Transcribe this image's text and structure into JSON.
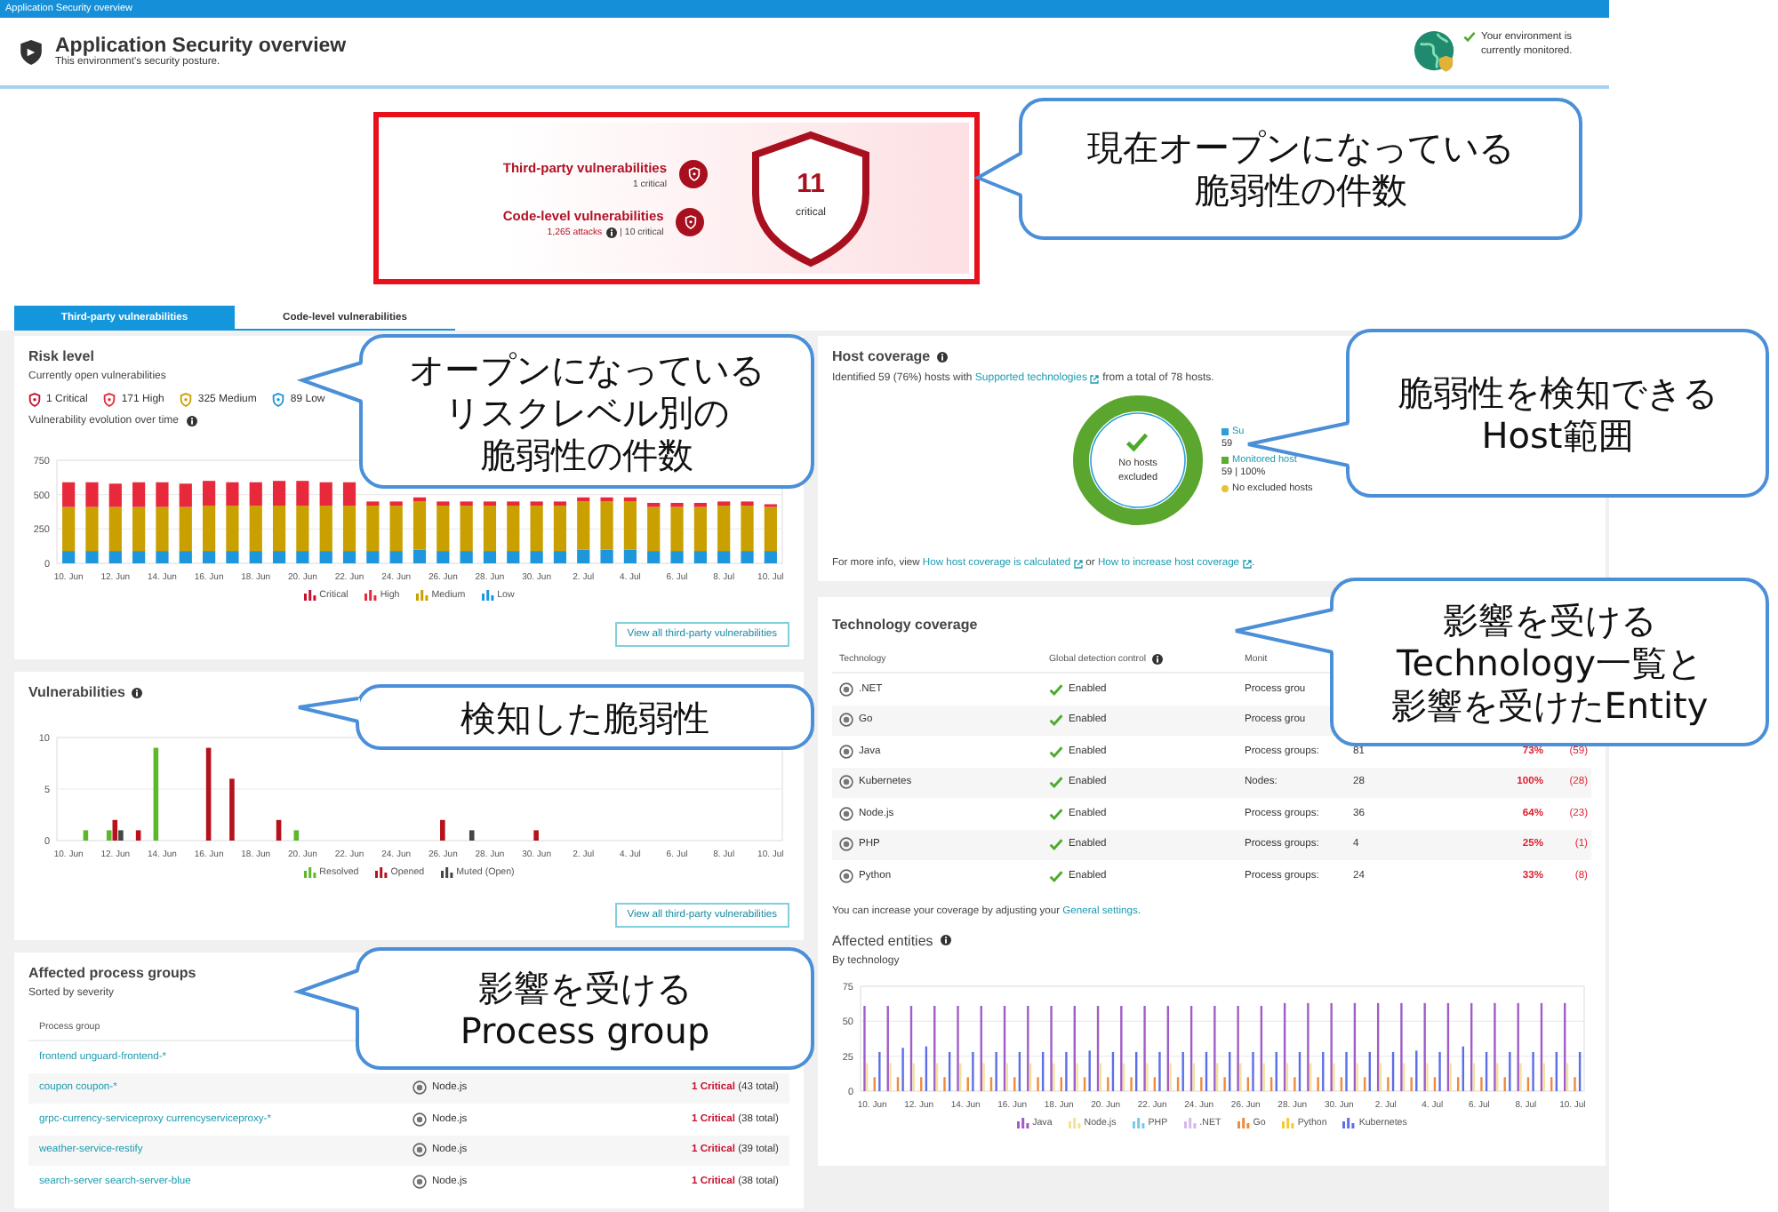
{
  "window": {
    "title": "Application Security overview"
  },
  "header": {
    "title": "Application Security overview",
    "subtitle": "This environment's security posture.",
    "status": "Your environment is currently monitored."
  },
  "summary": {
    "items": [
      {
        "title": "Third-party vulnerabilities",
        "detail": "1 critical"
      },
      {
        "title": "Code-level vulnerabilities",
        "attacks": "1,265 attacks",
        "detail": "| 10 critical"
      }
    ],
    "total": "11",
    "total_label": "critical"
  },
  "tabs": [
    {
      "label": "Third-party vulnerabilities",
      "selected": true
    },
    {
      "label": "Code-level vulnerabilities",
      "selected": false
    }
  ],
  "risk_level": {
    "title": "Risk level",
    "subtitle": "Currently open vulnerabilities",
    "counts": [
      {
        "label": "1 Critical",
        "color": "#c8102e"
      },
      {
        "label": "171 High",
        "color": "#e8293b"
      },
      {
        "label": "325 Medium",
        "color": "#c9a000"
      },
      {
        "label": "89 Low",
        "color": "#1e96dc"
      }
    ],
    "chart_title": "Vulnerability evolution over time",
    "chart_data": {
      "type": "bar",
      "stacked": true,
      "categories": [
        "10. Jun",
        null,
        "12. Jun",
        null,
        "14. Jun",
        null,
        "16. Jun",
        null,
        "18. Jun",
        null,
        "20. Jun",
        null,
        "22. Jun",
        null,
        "24. Jun",
        null,
        "26. Jun",
        null,
        "28. Jun",
        null,
        "30. Jun",
        null,
        "2. Jul",
        null,
        "4. Jul",
        null,
        "6. Jul",
        null,
        "8. Jul",
        null,
        "10. Jul"
      ],
      "ylim": [
        0,
        750
      ],
      "yticks": [
        0,
        250,
        500,
        750
      ],
      "series": [
        {
          "name": "Critical",
          "color": "#c8102e",
          "values": [
            null,
            null,
            null,
            null,
            null,
            null,
            null,
            null,
            null,
            null,
            null,
            null,
            null,
            null,
            null,
            null,
            null,
            null,
            null,
            null,
            null,
            null,
            null,
            null,
            null,
            null,
            null,
            null,
            null,
            null,
            null
          ]
        },
        {
          "name": "High",
          "color": "#e8293b",
          "values": [
            180,
            180,
            170,
            180,
            180,
            170,
            180,
            170,
            170,
            180,
            180,
            170,
            170,
            30,
            30,
            30,
            30,
            30,
            30,
            30,
            30,
            30,
            30,
            30,
            30,
            30,
            30,
            30,
            30,
            30,
            20
          ]
        },
        {
          "name": "Medium",
          "color": "#c9a000",
          "values": [
            320,
            320,
            320,
            320,
            320,
            320,
            330,
            330,
            330,
            330,
            330,
            330,
            330,
            330,
            330,
            350,
            330,
            330,
            330,
            330,
            330,
            330,
            350,
            350,
            350,
            320,
            320,
            320,
            330,
            330,
            320
          ]
        },
        {
          "name": "Low",
          "color": "#1e96dc",
          "values": [
            90,
            90,
            90,
            90,
            90,
            90,
            90,
            90,
            90,
            90,
            90,
            90,
            90,
            90,
            90,
            100,
            90,
            90,
            90,
            90,
            90,
            90,
            100,
            100,
            100,
            90,
            90,
            90,
            90,
            90,
            90
          ]
        }
      ]
    },
    "button": "View all third-party vulnerabilities"
  },
  "vulnerabilities": {
    "title": "Vulnerabilities",
    "chart_data": {
      "type": "bar",
      "categories": [
        "10. Jun",
        null,
        "12. Jun",
        null,
        "14. Jun",
        null,
        "16. Jun",
        null,
        "18. Jun",
        null,
        "20. Jun",
        null,
        "22. Jun",
        null,
        "24. Jun",
        null,
        "26. Jun",
        null,
        "28. Jun",
        null,
        "30. Jun",
        null,
        "2. Jul",
        null,
        "4. Jul",
        null,
        "6. Jul",
        null,
        "8. Jul",
        null,
        "10. Jul"
      ],
      "ylim": [
        0,
        10
      ],
      "yticks": [
        0,
        5,
        10
      ],
      "series": [
        {
          "name": "Resolved",
          "color": "#5cb82b",
          "values": [
            0,
            1,
            1,
            0,
            9,
            0,
            0,
            0,
            0,
            0,
            1,
            0,
            0,
            0,
            0,
            0,
            0,
            0,
            0,
            0,
            0,
            0,
            0,
            0,
            0,
            0,
            0,
            0,
            0,
            0,
            0
          ]
        },
        {
          "name": "Opened",
          "color": "#b5121b",
          "values": [
            0,
            0,
            2,
            1,
            0,
            0,
            9,
            6,
            0,
            2,
            0,
            0,
            0,
            0,
            0,
            0,
            2,
            0,
            0,
            0,
            1,
            0,
            0,
            0,
            0,
            0,
            0,
            0,
            0,
            0,
            0
          ]
        },
        {
          "name": "Muted (Open)",
          "color": "#454545",
          "values": [
            0,
            0,
            1,
            0,
            0,
            0,
            0,
            0,
            0,
            0,
            0,
            0,
            0,
            0,
            0,
            0,
            0,
            1,
            0,
            0,
            0,
            0,
            0,
            0,
            0,
            0,
            0,
            0,
            0,
            0,
            0
          ]
        }
      ]
    },
    "button": "View all third-party vulnerabilities"
  },
  "process_groups": {
    "title": "Affected process groups",
    "subtitle": "Sorted by severity",
    "columns": [
      "Process group"
    ],
    "rows": [
      {
        "name": "frontend unguard-frontend-*"
      },
      {
        "name": "coupon coupon-*",
        "technology": "Node.js",
        "severity": "1 Critical",
        "total": "(43 total)"
      },
      {
        "name": "grpc-currency-serviceproxy currencyserviceproxy-*",
        "technology": "Node.js",
        "severity": "1 Critical",
        "total": "(38 total)"
      },
      {
        "name": "weather-service-restify",
        "technology": "Node.js",
        "severity": "1 Critical",
        "total": "(39 total)"
      },
      {
        "name": "search-server search-server-blue",
        "technology": "Node.js",
        "severity": "1 Critical",
        "total": "(38 total)"
      }
    ]
  },
  "host_coverage": {
    "title": "Host coverage",
    "intro": {
      "before": "Identified 59 (76%) hosts with ",
      "link": "Supported technologies",
      "after": " from a total of 78 hosts."
    },
    "donut_label": "No hosts excluded",
    "legend": [
      {
        "label": "Su",
        "value": "59",
        "kind": "square",
        "color": "#2a9fd8"
      },
      {
        "label": "Monitored host",
        "value": "59 | 100%",
        "kind": "square",
        "color": "#5aad2e"
      },
      {
        "label": "No excluded hosts",
        "kind": "dot",
        "color": "#e8c234"
      }
    ],
    "footer": {
      "before": "For more info, view ",
      "link1": "How host coverage is calculated",
      "middle": " or ",
      "link2": "How to increase host coverage",
      "after": "."
    }
  },
  "technology_coverage": {
    "title": "Technology coverage",
    "columns": [
      "Technology",
      "Global detection control",
      "Monit"
    ],
    "rows": [
      {
        "name": ".NET",
        "detection": "Enabled",
        "label": "Process grou"
      },
      {
        "name": "Go",
        "detection": "Enabled",
        "label": "Process grou"
      },
      {
        "name": "Java",
        "detection": "Enabled",
        "label": "Process groups:",
        "count": "81",
        "percent": "73%",
        "affected": "(59)"
      },
      {
        "name": "Kubernetes",
        "detection": "Enabled",
        "label": "Nodes:",
        "count": "28",
        "percent": "100%",
        "affected": "(28)"
      },
      {
        "name": "Node.js",
        "detection": "Enabled",
        "label": "Process groups:",
        "count": "36",
        "percent": "64%",
        "affected": "(23)"
      },
      {
        "name": "PHP",
        "detection": "Enabled",
        "label": "Process groups:",
        "count": "4",
        "percent": "25%",
        "affected": "(1)"
      },
      {
        "name": "Python",
        "detection": "Enabled",
        "label": "Process groups:",
        "count": "24",
        "percent": "33%",
        "affected": "(8)"
      }
    ],
    "footer": {
      "before": "You can increase your coverage by adjusting your ",
      "link": "General settings",
      "after": "."
    }
  },
  "affected_entities": {
    "title": "Affected entities",
    "subtitle": "By technology",
    "chart_data": {
      "type": "bar",
      "categories": [
        "10. Jun",
        null,
        "12. Jun",
        null,
        "14. Jun",
        null,
        "16. Jun",
        null,
        "18. Jun",
        null,
        "20. Jun",
        null,
        "22. Jun",
        null,
        "24. Jun",
        null,
        "26. Jun",
        null,
        "28. Jun",
        null,
        "30. Jun",
        null,
        "2. Jul",
        null,
        "4. Jul",
        null,
        "6. Jul",
        null,
        "8. Jul",
        null,
        "10. Jul"
      ],
      "ylim": [
        0,
        75
      ],
      "yticks": [
        0,
        25,
        50,
        75
      ],
      "series": [
        {
          "name": "Java",
          "color": "#a05cc8",
          "values": [
            61,
            61,
            61,
            61,
            61,
            61,
            61,
            61,
            61,
            61,
            61,
            61,
            61,
            61,
            61,
            61,
            61,
            61,
            63,
            63,
            63,
            63,
            63,
            63,
            63,
            63,
            63,
            63,
            63,
            63,
            63
          ]
        },
        {
          "name": "Node.js",
          "color": "#f2e39a",
          "values": [
            20,
            20,
            20,
            20,
            20,
            20,
            20,
            20,
            20,
            20,
            20,
            20,
            20,
            20,
            20,
            20,
            20,
            20,
            20,
            20,
            20,
            20,
            20,
            20,
            20,
            20,
            20,
            20,
            20,
            20,
            20
          ]
        },
        {
          "name": "PHP",
          "color": "#7cc8e8",
          "values": [
            0,
            0,
            0,
            0,
            0,
            0,
            0,
            0,
            0,
            0,
            0,
            0,
            0,
            0,
            0,
            0,
            0,
            0,
            0,
            0,
            0,
            0,
            0,
            0,
            0,
            0,
            0,
            0,
            0,
            0,
            0
          ]
        },
        {
          "name": ".NET",
          "color": "#d7b8ec",
          "values": [
            0,
            0,
            0,
            0,
            0,
            0,
            0,
            0,
            0,
            0,
            0,
            0,
            0,
            0,
            0,
            0,
            0,
            0,
            0,
            0,
            0,
            0,
            0,
            0,
            0,
            0,
            0,
            0,
            0,
            0,
            0
          ]
        },
        {
          "name": "Go",
          "color": "#f08a3c",
          "values": [
            10,
            10,
            10,
            10,
            10,
            10,
            10,
            10,
            10,
            10,
            10,
            10,
            10,
            10,
            10,
            10,
            10,
            10,
            10,
            10,
            10,
            10,
            10,
            10,
            10,
            10,
            10,
            10,
            10,
            10,
            10
          ]
        },
        {
          "name": "Python",
          "color": "#f5c83a",
          "values": [
            0,
            0,
            0,
            0,
            0,
            0,
            0,
            0,
            0,
            0,
            0,
            0,
            0,
            0,
            0,
            0,
            0,
            0,
            0,
            0,
            0,
            0,
            0,
            0,
            0,
            0,
            0,
            0,
            0,
            0,
            0
          ]
        },
        {
          "name": "Kubernetes",
          "color": "#5b6ee8",
          "values": [
            28,
            31,
            32,
            28,
            28,
            28,
            28,
            28,
            28,
            29,
            28,
            28,
            28,
            28,
            28,
            28,
            28,
            28,
            28,
            28,
            28,
            28,
            28,
            29,
            28,
            32,
            28,
            28,
            28,
            28,
            28
          ]
        }
      ]
    }
  },
  "callouts": [
    {
      "lines": [
        "現在オープンになっている",
        "脆弱性の件数"
      ]
    },
    {
      "lines": [
        "オープンになっている",
        "リスクレベル別の",
        "脆弱性の件数"
      ]
    },
    {
      "lines": [
        "検知した脆弱性"
      ]
    },
    {
      "lines": [
        "影響を受ける",
        "Process group"
      ]
    },
    {
      "lines": [
        "脆弱性を検知できる",
        "Host範囲"
      ]
    },
    {
      "lines": [
        "影響を受ける",
        "Technology一覧と",
        "影響を受けたEntity"
      ]
    }
  ]
}
